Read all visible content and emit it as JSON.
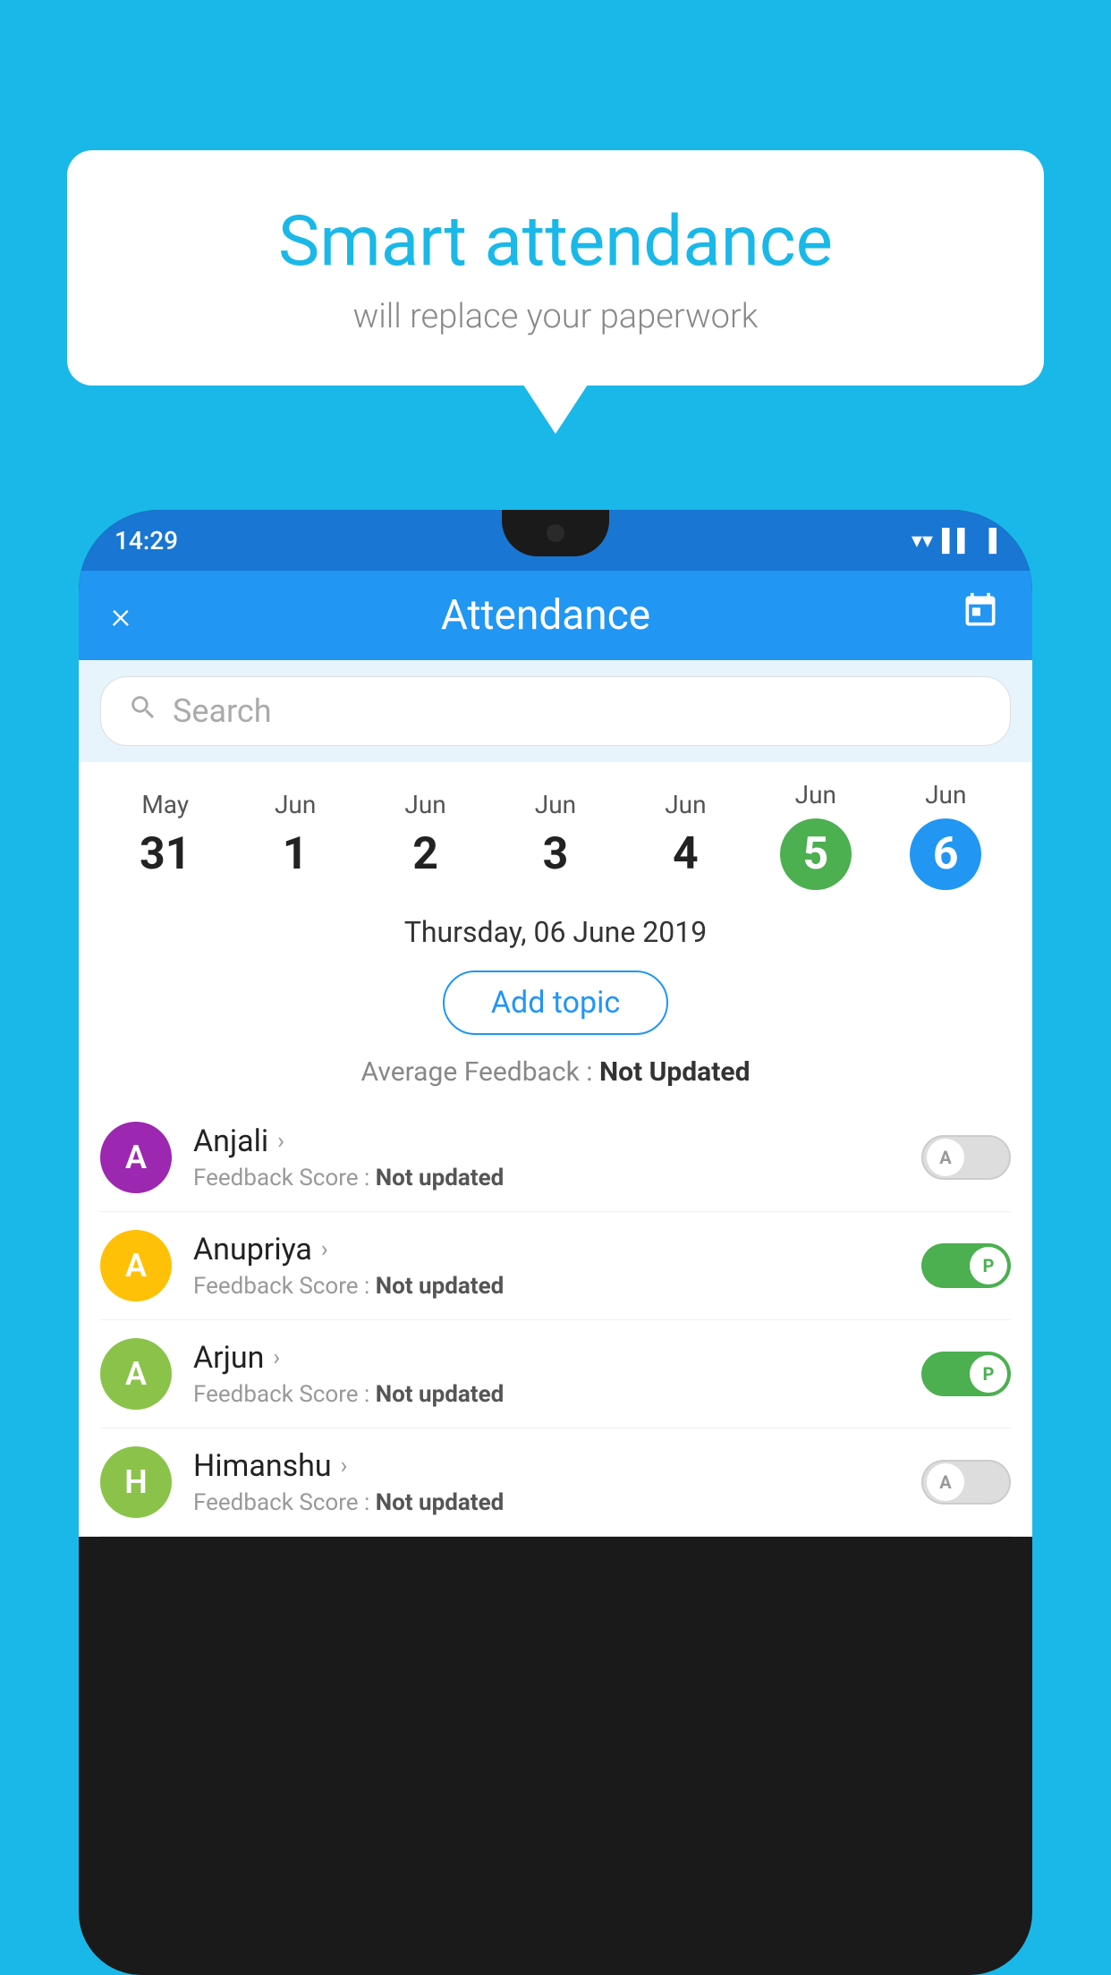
{
  "background_color": "#1ab8e8",
  "speech_bubble": {
    "title": "Smart attendance",
    "subtitle": "will replace your paperwork"
  },
  "status_bar": {
    "time": "14:29",
    "icons": [
      "wifi",
      "signal",
      "battery"
    ]
  },
  "app_bar": {
    "close_label": "×",
    "title": "Attendance",
    "calendar_icon": "📅"
  },
  "search": {
    "placeholder": "Search"
  },
  "dates": [
    {
      "month": "May",
      "day": "31",
      "state": "normal"
    },
    {
      "month": "Jun",
      "day": "1",
      "state": "normal"
    },
    {
      "month": "Jun",
      "day": "2",
      "state": "normal"
    },
    {
      "month": "Jun",
      "day": "3",
      "state": "normal"
    },
    {
      "month": "Jun",
      "day": "4",
      "state": "normal"
    },
    {
      "month": "Jun",
      "day": "5",
      "state": "today"
    },
    {
      "month": "Jun",
      "day": "6",
      "state": "selected"
    }
  ],
  "selected_date_label": "Thursday, 06 June 2019",
  "add_topic_label": "Add topic",
  "avg_feedback_label": "Average Feedback : ",
  "avg_feedback_value": "Not Updated",
  "students": [
    {
      "name": "Anjali",
      "initial": "A",
      "avatar_color": "#9c27b0",
      "feedback_label": "Feedback Score : ",
      "feedback_value": "Not updated",
      "attendance": "absent"
    },
    {
      "name": "Anupriya",
      "initial": "A",
      "avatar_color": "#ffc107",
      "feedback_label": "Feedback Score : ",
      "feedback_value": "Not updated",
      "attendance": "present"
    },
    {
      "name": "Arjun",
      "initial": "A",
      "avatar_color": "#8bc34a",
      "feedback_label": "Feedback Score : ",
      "feedback_value": "Not updated",
      "attendance": "present"
    },
    {
      "name": "Himanshu",
      "initial": "H",
      "avatar_color": "#8bc34a",
      "feedback_label": "Feedback Score : ",
      "feedback_value": "Not updated",
      "attendance": "absent"
    }
  ],
  "toggle_present_label": "P",
  "toggle_absent_label": "A"
}
